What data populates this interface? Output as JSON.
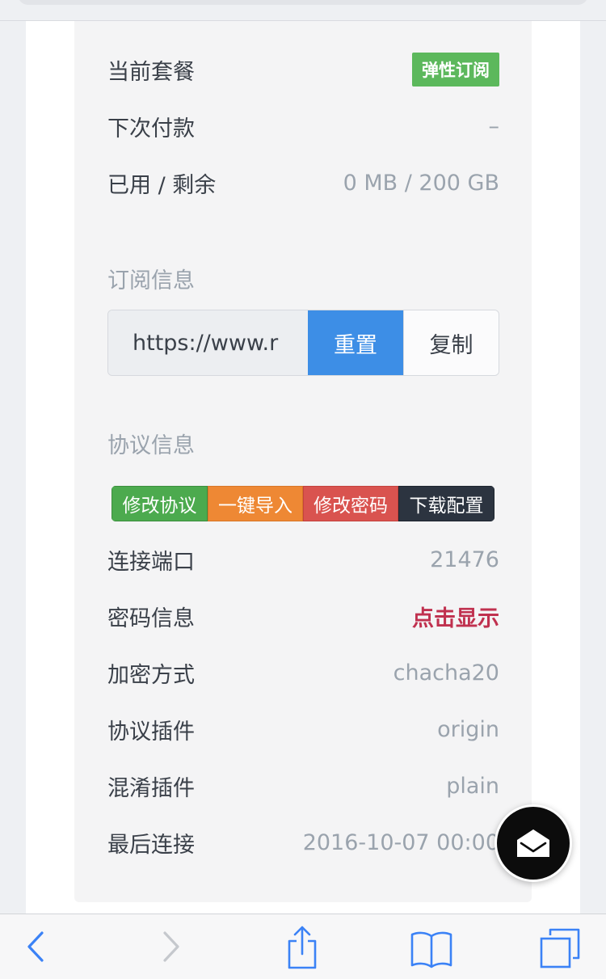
{
  "plan": {
    "current_label": "当前套餐",
    "current_value": "弹性订阅",
    "next_pay_label": "下次付款",
    "next_pay_value": "–",
    "usage_label": "已用 / 剩余",
    "usage_value": "0 MB / 200 GB"
  },
  "subscription": {
    "title": "订阅信息",
    "url_value": "https://www.r",
    "reset_label": "重置",
    "copy_label": "复制"
  },
  "protocol": {
    "title": "协议信息",
    "buttons": [
      "修改协议",
      "一键导入",
      "修改密码",
      "下载配置"
    ],
    "rows": [
      {
        "label": "连接端口",
        "value": "21476"
      },
      {
        "label": "密码信息",
        "value": "点击显示"
      },
      {
        "label": "加密方式",
        "value": "chacha20"
      },
      {
        "label": "协议插件",
        "value": "origin"
      },
      {
        "label": "混淆插件",
        "value": "plain"
      },
      {
        "label": "最后连接",
        "value": "2016-10-07 00:00"
      }
    ]
  },
  "colors": {
    "accent_blue": "#3d8ee6",
    "badge_green": "#5cb85c",
    "reveal_red": "#c0314f"
  },
  "icons": {
    "fab": "envelope-icon",
    "toolbar": [
      "back-icon",
      "forward-icon",
      "share-icon",
      "bookmarks-icon",
      "tabs-icon"
    ]
  }
}
